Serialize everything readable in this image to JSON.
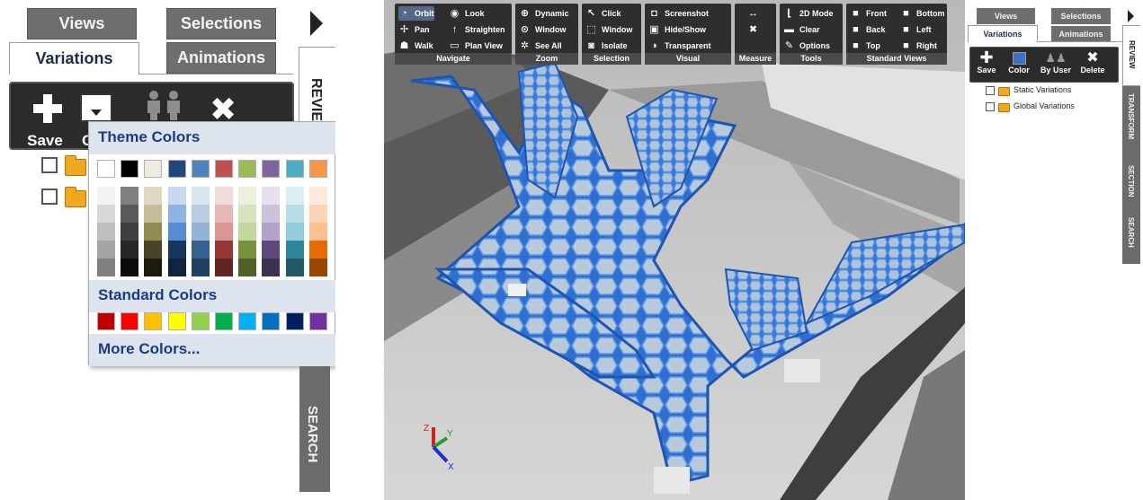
{
  "zoom_panel": {
    "tabs": {
      "views": "Views",
      "selections": "Selections",
      "variations": "Variations",
      "animations": "Animations"
    },
    "side_tabs": {
      "review": "REVIEW",
      "search": "SEARCH"
    },
    "toolbar": {
      "save_label": "Save",
      "color_label_partial": "C"
    },
    "color_picker": {
      "theme_header": "Theme Colors",
      "theme_top_row": [
        "#ffffff",
        "#000000",
        "#eeece1",
        "#1f497d",
        "#4f81bd",
        "#c0504d",
        "#9bbb59",
        "#8064a2",
        "#4bacc6",
        "#f79646"
      ],
      "theme_shades": [
        [
          "#f2f2f2",
          "#d8d8d8",
          "#bfbfbf",
          "#a5a5a5",
          "#7f7f7f"
        ],
        [
          "#7f7f7f",
          "#595959",
          "#3f3f3f",
          "#262626",
          "#0c0c0c"
        ],
        [
          "#ddd9c3",
          "#c4bd97",
          "#938953",
          "#494429",
          "#1d1b10"
        ],
        [
          "#c6d9f0",
          "#8db3e2",
          "#548dd4",
          "#17365d",
          "#0f243e"
        ],
        [
          "#dbe5f1",
          "#b8cce4",
          "#95b3d7",
          "#366092",
          "#244061"
        ],
        [
          "#f2dcdb",
          "#e5b9b7",
          "#d99694",
          "#953734",
          "#632423"
        ],
        [
          "#ebf1dd",
          "#d7e3bc",
          "#c3d69b",
          "#76923c",
          "#4f6128"
        ],
        [
          "#e5e0ec",
          "#ccc1d9",
          "#b2a2c7",
          "#5f497a",
          "#3f3151"
        ],
        [
          "#dbeef3",
          "#b7dde8",
          "#92cddc",
          "#31859b",
          "#205867"
        ],
        [
          "#fdeada",
          "#fbd5b5",
          "#fac08f",
          "#e36c09",
          "#974806"
        ]
      ],
      "standard_header": "Standard Colors",
      "standard_colors": [
        "#c00000",
        "#ff0000",
        "#ffc000",
        "#ffff00",
        "#92d050",
        "#00b050",
        "#00b0f0",
        "#0070c0",
        "#002060",
        "#7030a0"
      ],
      "more_colors": "More Colors..."
    }
  },
  "ribbon": {
    "groups": [
      {
        "label": "Navigate",
        "items": [
          {
            "icon": "orbit-icon",
            "glyph": "◔",
            "label": "Orbit",
            "selected": true
          },
          {
            "icon": "look-icon",
            "glyph": "◉",
            "label": "Look"
          },
          {
            "icon": "pan-icon",
            "glyph": "✢",
            "label": "Pan"
          },
          {
            "icon": "straighten-icon",
            "glyph": "↑",
            "label": "Straighten"
          },
          {
            "icon": "walk-icon",
            "glyph": "☗",
            "label": "Walk"
          },
          {
            "icon": "plan-view-icon",
            "glyph": "▭",
            "label": "Plan View"
          }
        ]
      },
      {
        "label": "Zoom",
        "items": [
          {
            "icon": "zoom-dynamic-icon",
            "glyph": "⊕",
            "label": "Dynamic"
          },
          {
            "icon": "zoom-window-icon",
            "glyph": "⊙",
            "label": "Window"
          },
          {
            "icon": "see-all-icon",
            "glyph": "✲",
            "label": "See All"
          }
        ]
      },
      {
        "label": "Selection",
        "items": [
          {
            "icon": "click-icon",
            "glyph": "↖",
            "label": "Click"
          },
          {
            "icon": "selection-window-icon",
            "glyph": "⬚",
            "label": "Window"
          },
          {
            "icon": "isolate-icon",
            "glyph": "◙",
            "label": "Isolate"
          }
        ]
      },
      {
        "label": "Visual",
        "items": [
          {
            "icon": "screenshot-icon",
            "glyph": "◘",
            "label": "Screenshot"
          },
          {
            "icon": "hide-show-icon",
            "glyph": "▣",
            "label": "Hide/Show"
          },
          {
            "icon": "transparent-icon",
            "glyph": "◑",
            "label": "Transparent"
          }
        ]
      },
      {
        "label": "Measure",
        "items": [
          {
            "icon": "measure-icon",
            "glyph": "↔",
            "label": ""
          },
          {
            "icon": "clear-measure-icon",
            "glyph": "✖",
            "label": ""
          }
        ]
      },
      {
        "label": "Tools",
        "items": [
          {
            "icon": "2d-mode-icon",
            "glyph": "⌊",
            "label": "2D Mode"
          },
          {
            "icon": "clear-icon",
            "glyph": "▬",
            "label": "Clear"
          },
          {
            "icon": "options-icon",
            "glyph": "✎",
            "label": "Options"
          }
        ]
      },
      {
        "label": "Standard Views",
        "items": [
          {
            "icon": "front-view-icon",
            "glyph": "■",
            "label": "Front"
          },
          {
            "icon": "bottom-view-icon",
            "glyph": "■",
            "label": "Bottom"
          },
          {
            "icon": "back-view-icon",
            "glyph": "■",
            "label": "Back"
          },
          {
            "icon": "left-view-icon",
            "glyph": "■",
            "label": "Left"
          },
          {
            "icon": "top-view-icon",
            "glyph": "■",
            "label": "Top"
          },
          {
            "icon": "right-view-icon",
            "glyph": "■",
            "label": "Right"
          }
        ]
      }
    ]
  },
  "axes": {
    "x": "X",
    "y": "Y",
    "z": "Z"
  },
  "right_panel": {
    "tabs": {
      "views": "Views",
      "selections": "Selections",
      "variations": "Variations",
      "animations": "Animations"
    },
    "toolbar": {
      "save": "Save",
      "color": "Color",
      "by_user": "By User",
      "delete": "Delete"
    },
    "side_tabs": {
      "review": "REVIEW",
      "transform": "TRANSFORM",
      "section": "SECTION",
      "search": "SEARCH"
    },
    "tree": [
      {
        "label": "Static Variations"
      },
      {
        "label": "Global Variations"
      }
    ]
  }
}
